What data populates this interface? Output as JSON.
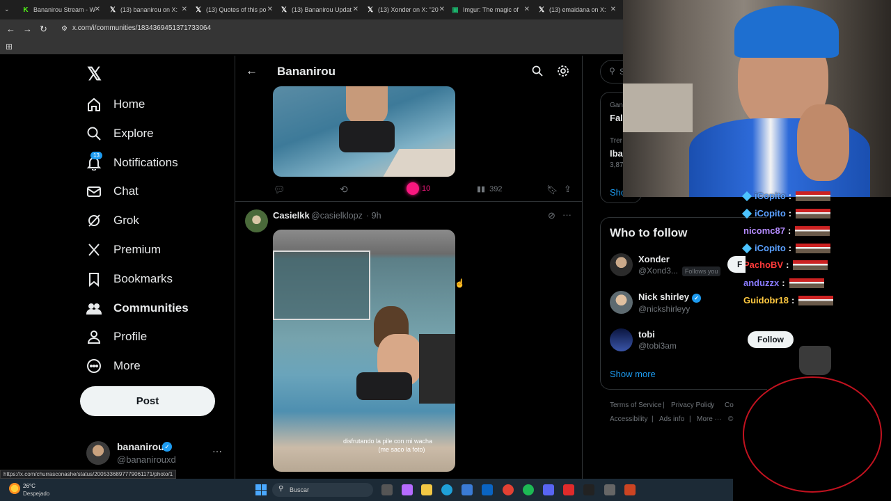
{
  "browser": {
    "tabs": [
      {
        "label": "Bananirou Stream - W",
        "icon": "kick-icon",
        "color": "#53fc18"
      },
      {
        "label": "(13) bananirou on X:",
        "icon": "x-icon",
        "color": "#ffffff"
      },
      {
        "label": "(13) Quotes of this po",
        "icon": "x-icon",
        "color": "#ffffff"
      },
      {
        "label": "(13) Bananirou Updat",
        "icon": "x-icon",
        "color": "#ffffff"
      },
      {
        "label": "(13) Xonder on X: \"20",
        "icon": "x-icon",
        "color": "#ffffff"
      },
      {
        "label": "Imgur: The magic of",
        "icon": "imgur-icon",
        "color": "#1bb76e"
      },
      {
        "label": "(13) emaidana on X:",
        "icon": "x-icon",
        "color": "#ffffff"
      }
    ],
    "url": "x.com/i/communities/1834369451371733064",
    "status_url": "https://x.com/churrasconashe/status/2005336897779061171/photo/1"
  },
  "sidebar": {
    "items": [
      {
        "label": "Home",
        "icon": "home-icon"
      },
      {
        "label": "Explore",
        "icon": "search-icon"
      },
      {
        "label": "Notifications",
        "icon": "bell-icon",
        "badge": "13"
      },
      {
        "label": "Chat",
        "icon": "mail-icon"
      },
      {
        "label": "Grok",
        "icon": "grok-icon"
      },
      {
        "label": "Premium",
        "icon": "x-logo-icon"
      },
      {
        "label": "Bookmarks",
        "icon": "bookmark-icon"
      },
      {
        "label": "Communities",
        "icon": "communities-icon"
      },
      {
        "label": "Profile",
        "icon": "person-icon"
      },
      {
        "label": "More",
        "icon": "more-circle-icon"
      }
    ],
    "post_label": "Post",
    "account": {
      "name": "bananirou",
      "handle": "@bananirouxd"
    }
  },
  "header": {
    "title": "Bananirou"
  },
  "post1": {
    "likes": "10",
    "views": "392"
  },
  "post2": {
    "name": "Casielkk",
    "handle": "@casielklopz",
    "time": "· 9h",
    "caption_line1": "disfrutando la pile con mi wacha",
    "caption_line2": "(me saco la foto)"
  },
  "right": {
    "search_placeholder": "S",
    "trend1_context": "Gan",
    "trend1_title": "Fall",
    "trend2_context": "Trer",
    "trend2_title": "Iba",
    "trend2_count": "3,87",
    "show_more_partial": "Sho",
    "wtf_title": "Who to follow",
    "wtf": [
      {
        "name": "Xonder",
        "handle": "@Xond3...",
        "tag": "Follows you",
        "verified": false
      },
      {
        "name": "Nick shirley",
        "handle": "@nickshirleyy",
        "verified": true
      },
      {
        "name": "tobi",
        "handle": "@tobi3am",
        "verified": false
      }
    ],
    "show_more": "Show more",
    "footer": [
      "Terms of Service",
      "|",
      "Privacy Policy",
      "|",
      "Co",
      "Accessibility",
      "|",
      "Ads info",
      "|",
      "More ···",
      "©"
    ]
  },
  "chat": {
    "lines": [
      {
        "user": "iCopito",
        "color": "#5aa0ff"
      },
      {
        "user": "iCopito",
        "color": "#5aa0ff"
      },
      {
        "user": "nicomc87",
        "color": "#b58cff"
      },
      {
        "user": "iCopito",
        "color": "#5aa0ff"
      },
      {
        "user": "PachoBV",
        "color": "#ff3a3a"
      },
      {
        "user": "anduzzx",
        "color": "#8a7cff"
      },
      {
        "user": "Guidobr18",
        "color": "#ffc940"
      }
    ],
    "follow_partial": "F",
    "follow_button": "Follow"
  },
  "taskbar": {
    "weather_temp": "26°C",
    "weather_desc": "Despejado",
    "search_label": "Buscar"
  }
}
